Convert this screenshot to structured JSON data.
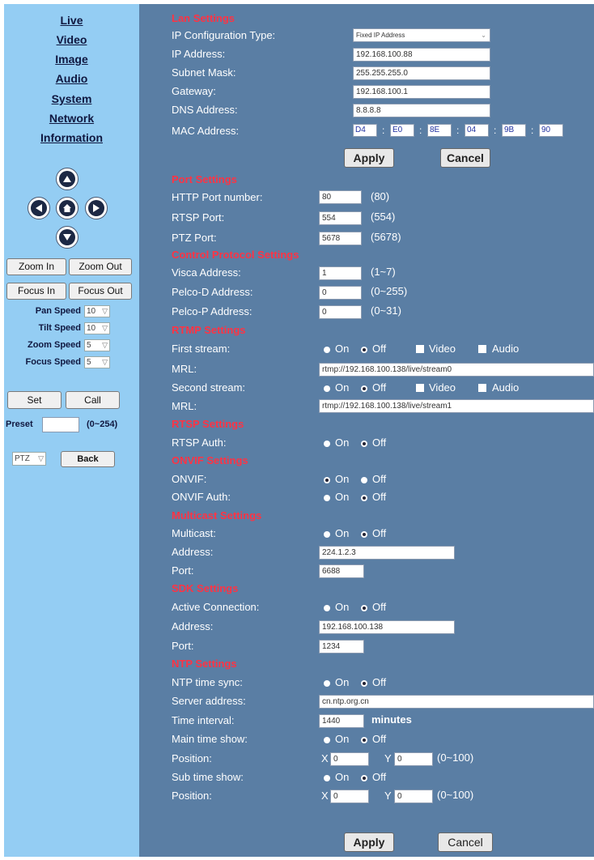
{
  "nav": [
    "Live",
    "Video",
    "Image",
    "Audio",
    "System",
    "Network",
    "Information"
  ],
  "ptz": {
    "zoom_in": "Zoom In",
    "zoom_out": "Zoom Out",
    "focus_in": "Focus In",
    "focus_out": "Focus Out",
    "pan_speed_label": "Pan Speed",
    "pan_speed": "10",
    "tilt_speed_label": "Tilt Speed",
    "tilt_speed": "10",
    "zoom_speed_label": "Zoom Speed",
    "zoom_speed": "5",
    "focus_speed_label": "Focus Speed",
    "focus_speed": "5",
    "set": "Set",
    "call": "Call",
    "preset_label": "Preset",
    "preset_value": "",
    "preset_range": "(0~254)",
    "mode": "PTZ",
    "back": "Back"
  },
  "lan": {
    "title": "Lan Settings",
    "ip_type_label": "IP Configuration Type:",
    "ip_type": "Fixed IP Address",
    "ip_label": "IP Address:",
    "ip": "192.168.100.88",
    "mask_label": "Subnet Mask:",
    "mask": "255.255.255.0",
    "gateway_label": "Gateway:",
    "gateway": "192.168.100.1",
    "dns_label": "DNS Address:",
    "dns": "8.8.8.8",
    "mac_label": "MAC Address:",
    "mac": [
      "D4",
      "E0",
      "8E",
      "04",
      "9B",
      "90"
    ],
    "apply": "Apply",
    "cancel": "Cancel"
  },
  "port": {
    "title": "Port Settings",
    "http_label": "HTTP Port number:",
    "http": "80",
    "http_hint": "(80)",
    "rtsp_label": "RTSP Port:",
    "rtsp": "554",
    "rtsp_hint": "(554)",
    "ptz_label": "PTZ Port:",
    "ptz": "5678",
    "ptz_hint": "(5678)"
  },
  "control": {
    "title": "Control Protocol Settings",
    "visca_label": "Visca Address:",
    "visca": "1",
    "visca_hint": "(1~7)",
    "pelcod_label": "Pelco-D Address:",
    "pelcod": "0",
    "pelcod_hint": "(0~255)",
    "pelcop_label": "Pelco-P Address:",
    "pelcop": "0",
    "pelcop_hint": "(0~31)"
  },
  "rtmp": {
    "title": "RTMP Settings",
    "first_label": "First stream:",
    "on": "On",
    "off": "Off",
    "video": "Video",
    "audio": "Audio",
    "mrl_label": "MRL:",
    "mrl1": "rtmp://192.168.100.138/live/stream0",
    "second_label": "Second stream:",
    "mrl2": "rtmp://192.168.100.138/live/stream1"
  },
  "rtsp": {
    "title": "RTSP Settings",
    "auth_label": "RTSP Auth:"
  },
  "onvif": {
    "title": "ONVIF Settings",
    "onvif_label": "ONVIF:",
    "auth_label": "ONVIF Auth:"
  },
  "multicast": {
    "title": "Multicast Settings",
    "label": "Multicast:",
    "address_label": "Address:",
    "address": "224.1.2.3",
    "port_label": "Port:",
    "port": "6688"
  },
  "sdk": {
    "title": "SDK Settings",
    "active_label": "Active Connection:",
    "address_label": "Address:",
    "address": "192.168.100.138",
    "port_label": "Port:",
    "port": "1234"
  },
  "ntp": {
    "title": "NTP Settings",
    "sync_label": "NTP time sync:",
    "server_label": "Server address:",
    "server": "cn.ntp.org.cn",
    "interval_label": "Time interval:",
    "interval": "1440",
    "interval_unit": "minutes",
    "main_label": "Main time show:",
    "pos_label": "Position:",
    "x": "X",
    "y": "Y",
    "main_x": "0",
    "main_y": "0",
    "range": "(0~100)",
    "sub_label": "Sub time show:",
    "sub_x": "0",
    "sub_y": "0"
  },
  "footer": {
    "apply": "Apply",
    "cancel": "Cancel"
  }
}
